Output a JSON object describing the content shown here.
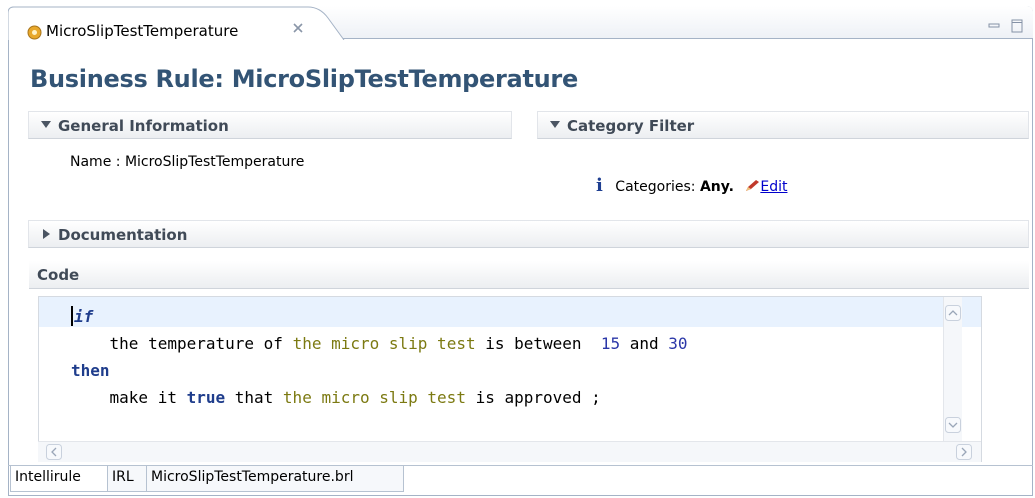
{
  "editor_tab": {
    "title": "MicroSlipTestTemperature",
    "icon": "rule-gear-icon",
    "close_icon": "close-icon"
  },
  "window_buttons": {
    "minimize_icon": "minimize-icon",
    "maximize_icon": "maximize-icon"
  },
  "page_title": "Business Rule: MicroSlipTestTemperature",
  "sections": {
    "general": {
      "label": "General Information",
      "expanded": true
    },
    "category": {
      "label": "Category Filter",
      "expanded": true
    },
    "documentation": {
      "label": "Documentation",
      "expanded": false
    },
    "code": {
      "label": "Code"
    }
  },
  "general_info": {
    "name_label": "Name :",
    "name_value": "MicroSlipTestTemperature"
  },
  "category_filter": {
    "info_icon": "info-icon",
    "prefix": "Categories:",
    "value": "Any.",
    "edit_label": "Edit",
    "edit_icon": "pencil-icon"
  },
  "code": {
    "if_kw": "if",
    "cond_part1": "    the temperature of ",
    "cond_term": "the micro slip test",
    "cond_part2": " is between  ",
    "num1": "15",
    "cond_and": " and ",
    "num2": "30",
    "then_kw": "then",
    "act_part1": "    make it ",
    "act_true": "true",
    "act_part2": " that ",
    "act_term": "the micro slip test",
    "act_part3": " is approved ;"
  },
  "bottom_tabs": [
    "Intellirule",
    "IRL",
    "MicroSlipTestTemperature.brl"
  ],
  "colors": {
    "title": "#335475",
    "keyword": "#1f3d8c",
    "term": "#7c7a12",
    "number": "#2b37a8",
    "link": "#0000cc"
  }
}
